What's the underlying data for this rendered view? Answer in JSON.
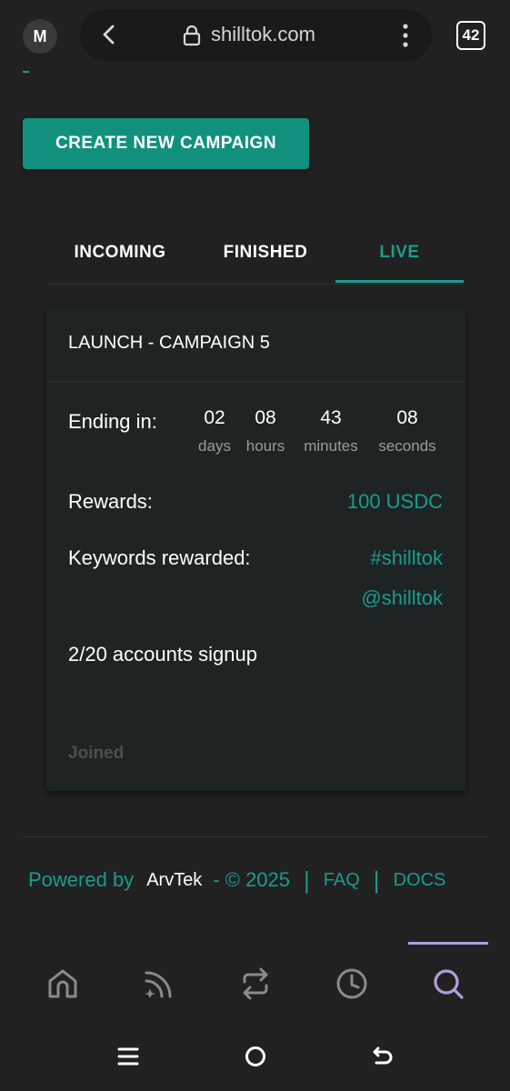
{
  "browser": {
    "avatar_letter": "M",
    "url": "shilltok.com",
    "tab_count": "42"
  },
  "actions": {
    "create_campaign_label": "CREATE NEW CAMPAIGN"
  },
  "tabs": [
    {
      "label": "INCOMING",
      "active": false
    },
    {
      "label": "FINISHED",
      "active": false
    },
    {
      "label": "LIVE",
      "active": true
    }
  ],
  "campaign": {
    "title": "LAUNCH - CAMPAIGN 5",
    "ending_label": "Ending in:",
    "countdown": {
      "days": "02",
      "days_label": "days",
      "hours": "08",
      "hours_label": "hours",
      "minutes": "43",
      "minutes_label": "minutes",
      "seconds": "08",
      "seconds_label": "seconds"
    },
    "rewards_label": "Rewards:",
    "rewards_value": "100 USDC",
    "keywords_label": "Keywords rewarded:",
    "keywords": [
      "#shilltok",
      "@shilltok"
    ],
    "signup_text": "2/20 accounts signup",
    "joined_label": "Joined"
  },
  "footer": {
    "powered_by": "Powered by",
    "brand": "ArvTek",
    "copyright": "- © 2025",
    "faq": "FAQ",
    "docs": "DOCS"
  },
  "bottom_nav": [
    "home-icon",
    "feed-icon",
    "swap-icon",
    "history-icon",
    "search-icon"
  ],
  "colors": {
    "accent": "#1a9c8c",
    "button": "#12907e",
    "background": "#212121",
    "card": "#1e2424",
    "nav_active": "#b39ddb"
  }
}
